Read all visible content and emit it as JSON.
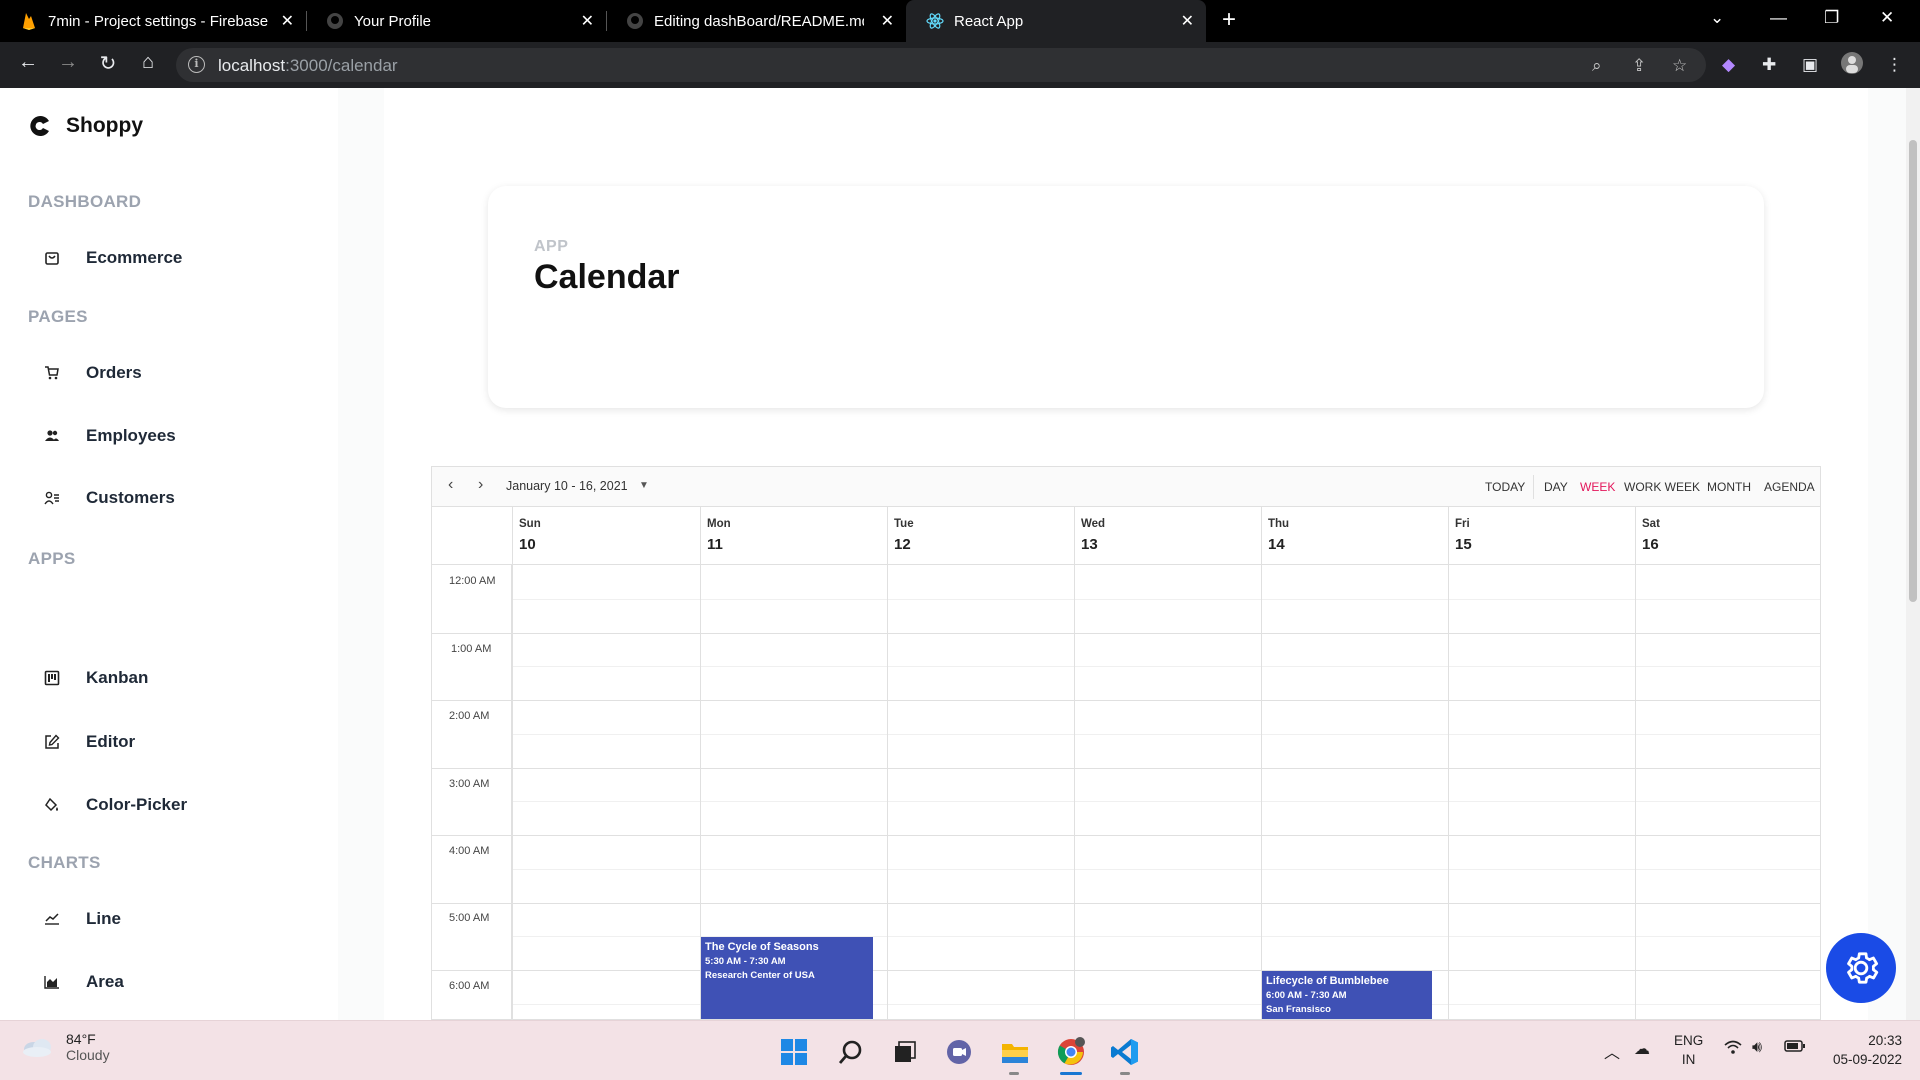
{
  "browser": {
    "tabs": [
      {
        "title": "7min - Project settings - Firebase",
        "icon": "firebase-icon"
      },
      {
        "title": "Your Profile",
        "icon": "github-icon"
      },
      {
        "title": "Editing dashBoard/README.md at",
        "icon": "github-icon"
      },
      {
        "title": "React App",
        "icon": "react-icon",
        "active": true
      }
    ],
    "url_host": "localhost",
    "url_path": ":3000/calendar"
  },
  "sidebar": {
    "brand": "Shoppy",
    "sections": {
      "dashboard": "DASHBOARD",
      "pages": "PAGES",
      "apps": "APPS",
      "charts": "CHARTS"
    },
    "items": {
      "ecommerce": "Ecommerce",
      "orders": "Orders",
      "employees": "Employees",
      "customers": "Customers",
      "kanban": "Kanban",
      "editor": "Editor",
      "color_picker": "Color-Picker",
      "line": "Line",
      "area": "Area"
    }
  },
  "header": {
    "category": "App",
    "title": "Calendar"
  },
  "calendar": {
    "date_range": "January 10 - 16, 2021",
    "views": {
      "today": "TODAY",
      "day": "DAY",
      "week": "WEEK",
      "work_week": "WORK WEEK",
      "month": "MONTH",
      "agenda": "AGENDA"
    },
    "active_view": "WEEK",
    "days": [
      {
        "name": "Sun",
        "date": "10"
      },
      {
        "name": "Mon",
        "date": "11"
      },
      {
        "name": "Tue",
        "date": "12"
      },
      {
        "name": "Wed",
        "date": "13"
      },
      {
        "name": "Thu",
        "date": "14"
      },
      {
        "name": "Fri",
        "date": "15"
      },
      {
        "name": "Sat",
        "date": "16"
      }
    ],
    "times": [
      "12:00 AM",
      "1:00 AM",
      "2:00 AM",
      "3:00 AM",
      "4:00 AM",
      "5:00 AM",
      "6:00 AM"
    ],
    "events": [
      {
        "title": "The Cycle of Seasons",
        "time": "5:30 AM - 7:30 AM",
        "location": "Research Center of USA",
        "day": "Mon"
      },
      {
        "title": "Lifecycle of Bumblebee",
        "time": "6:00 AM - 7:30 AM",
        "location": "San Fransisco",
        "day": "Thu"
      }
    ],
    "event_color": "#3f51b5",
    "accent_color": "#e3165b"
  },
  "taskbar": {
    "temperature": "84°F",
    "condition": "Cloudy",
    "lang_top": "ENG",
    "lang_bottom": "IN",
    "time": "20:33",
    "date": "05-09-2022"
  }
}
